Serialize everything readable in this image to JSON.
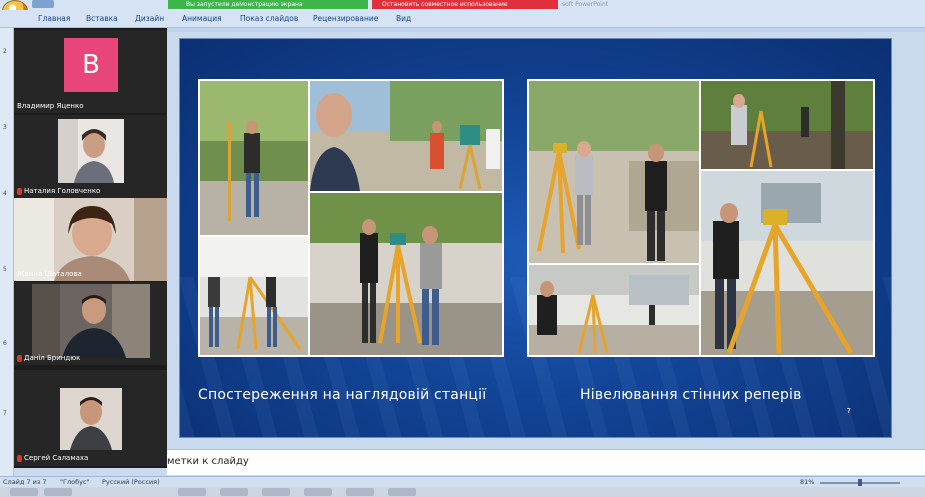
{
  "title_bar": {
    "share_status": "Вы запустили демонстрацию экрана",
    "stop_share": "Остановить совместное использование",
    "app_title": "soft PowerPoint"
  },
  "ribbon": {
    "tabs": [
      "Главная",
      "Вставка",
      "Дизайн",
      "Анимация",
      "Показ слайдов",
      "Рецензирование",
      "Вид"
    ]
  },
  "slide_panel": {
    "numbers": [
      "2",
      "3",
      "4",
      "5",
      "6",
      "7"
    ]
  },
  "participants": [
    {
      "name": "Владимир Яценко",
      "avatar_letter": "В",
      "avatar_color": "#e8467a",
      "muted": false
    },
    {
      "name": "Наталия Головченко",
      "muted": true
    },
    {
      "name": "Жанна Шаталова",
      "muted": false
    },
    {
      "name": "Даніл Бриндюк",
      "muted": true
    },
    {
      "name": "Сергей Саламаха",
      "muted": true
    }
  ],
  "slide": {
    "caption_left": "Спостереження на наглядовій станції",
    "caption_right": "Нівелювання стінних реперів",
    "slide_number": "7",
    "background": "#124496"
  },
  "notes": {
    "text": "метки к слайду"
  },
  "status_bar": {
    "slide_info": "Слайд 7 из 7",
    "theme": "\"Глобус\"",
    "language": "Русский (Россия)",
    "zoom": "81%"
  }
}
